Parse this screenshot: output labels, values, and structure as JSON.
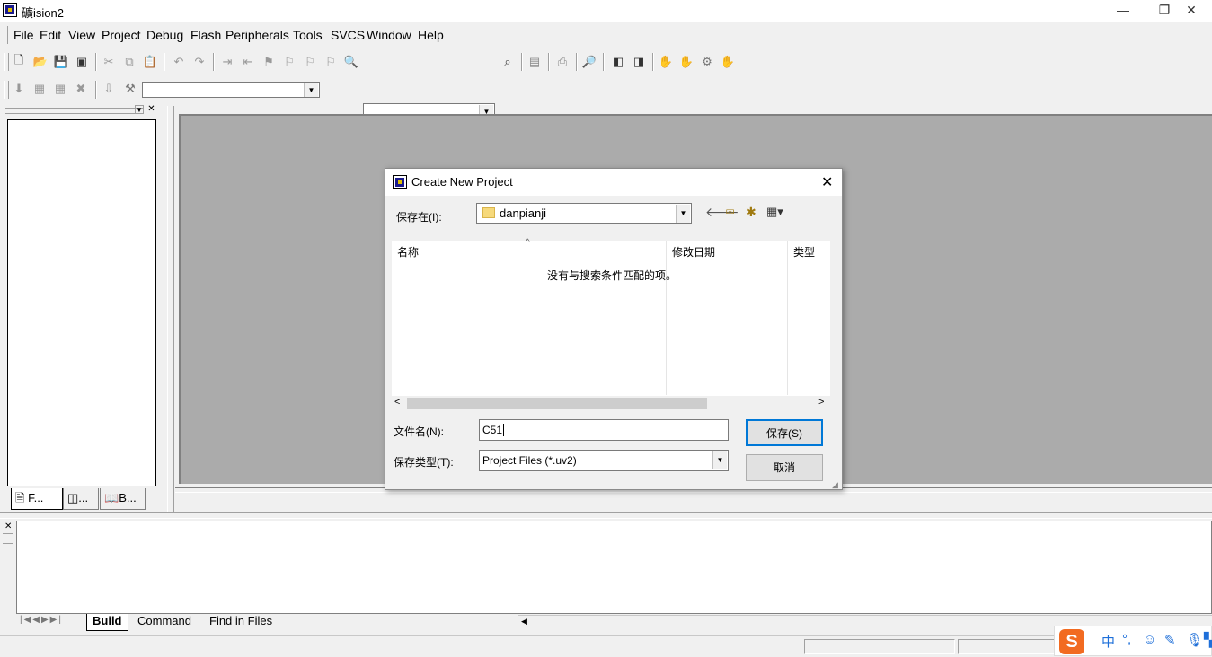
{
  "app": {
    "title": "礦ision2"
  },
  "window_controls": {
    "minimize": "—",
    "restore": "❐",
    "close": "✕"
  },
  "menu": {
    "items": [
      "File",
      "Edit",
      "View",
      "Project",
      "Debug",
      "Flash",
      "Peripherals",
      "Tools",
      "SVCS",
      "Window",
      "Help"
    ]
  },
  "toolbar": {
    "find_combo_value": "",
    "target_combo_value": ""
  },
  "project_panel": {
    "tabs": [
      "F...",
      "...",
      "B..."
    ]
  },
  "dialog": {
    "title": "Create New Project",
    "save_in_label": "保存在(I):",
    "folder": "danpianji",
    "columns": [
      "名称",
      "修改日期",
      "类型"
    ],
    "empty_message": "没有与搜索条件匹配的项。",
    "filename_label": "文件名(N):",
    "filename_value": "C51",
    "filetype_label": "保存类型(T):",
    "filetype_value": "Project Files (*.uv2)",
    "save_button": "保存(S)",
    "cancel_button": "取消"
  },
  "output": {
    "tabs": [
      "Build",
      "Command",
      "Find in Files"
    ]
  },
  "ime": {
    "lang": "中",
    "punct": "°,"
  }
}
